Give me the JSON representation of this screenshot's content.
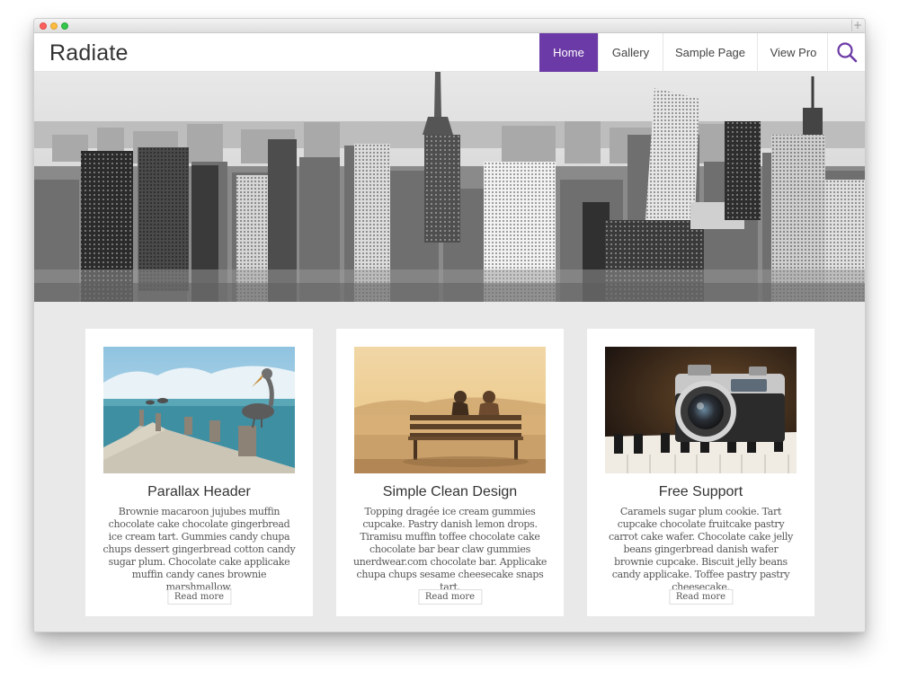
{
  "site": {
    "logo": "Radiate",
    "accent_color": "#6b3aa6"
  },
  "nav": {
    "items": [
      {
        "label": "Home",
        "active": true
      },
      {
        "label": "Gallery",
        "active": false
      },
      {
        "label": "Sample Page",
        "active": false
      },
      {
        "label": "View Pro",
        "active": false
      }
    ],
    "search_icon": "search-icon"
  },
  "hero": {
    "image": "city-skyline-grayscale"
  },
  "cards": [
    {
      "title": "Parallax Header",
      "text": "Brownie macaroon jujubes muffin chocolate cake chocolate gingerbread ice cream tart. Gummies candy chupa chups dessert gingerbread cotton candy sugar plum. Chocolate cake applicake muffin candy canes brownie marshmallow.",
      "button": "Read more",
      "image": "pelican-on-pier"
    },
    {
      "title": "Simple Clean Design",
      "text": "Topping dragée ice cream gummies cupcake. Pastry danish lemon drops. Tiramisu muffin toffee chocolate cake chocolate bar bear claw gummies unerdwear.com chocolate bar. Applicake chupa chups sesame cheesecake snaps tart.",
      "button": "Read more",
      "image": "couple-on-bench"
    },
    {
      "title": "Free Support",
      "text": "Caramels sugar plum cookie. Tart cupcake chocolate fruitcake pastry carrot cake wafer. Chocolate cake jelly beans gingerbread danish wafer brownie cupcake. Biscuit jelly beans candy applicake. Toffee pastry pastry cheesecake.",
      "button": "Read more",
      "image": "camera-on-piano"
    }
  ]
}
